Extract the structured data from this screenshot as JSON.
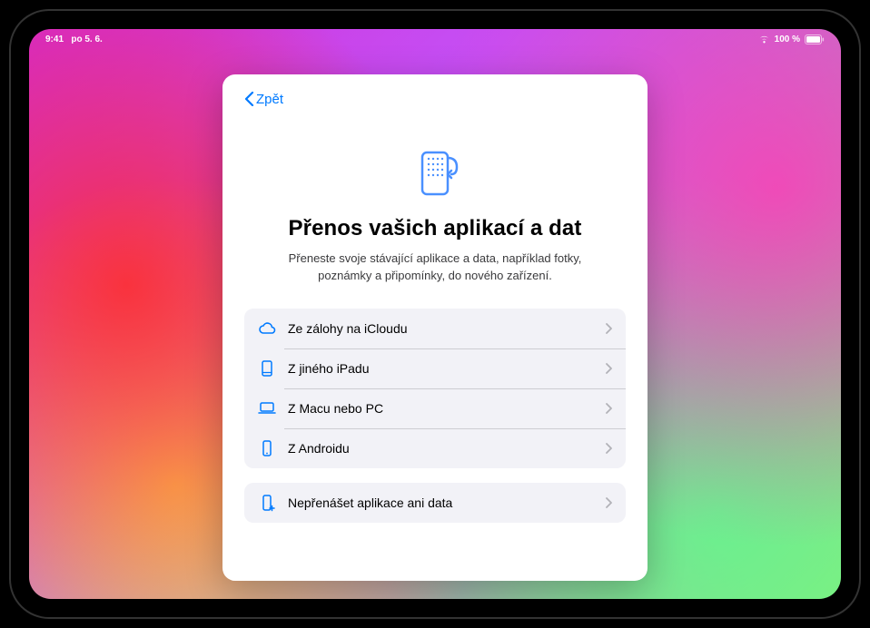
{
  "status": {
    "time": "9:41",
    "date": "po 5. 6.",
    "battery_pct": "100 %"
  },
  "nav": {
    "back_label": "Zpět"
  },
  "hero": {
    "title": "Přenos vašich aplikací a dat",
    "subtitle": "Přeneste svoje stávající aplikace a data, například fotky, poznámky a připomínky, do nového zařízení."
  },
  "options": {
    "group1": [
      {
        "icon": "cloud-icon",
        "label": "Ze zálohy na iCloudu"
      },
      {
        "icon": "ipad-icon",
        "label": "Z jiného iPadu"
      },
      {
        "icon": "laptop-icon",
        "label": "Z Macu nebo PC"
      },
      {
        "icon": "android-icon",
        "label": "Z Androidu"
      }
    ],
    "group2": [
      {
        "icon": "phone-plus-icon",
        "label": "Nepřenášet aplikace ani data"
      }
    ]
  }
}
